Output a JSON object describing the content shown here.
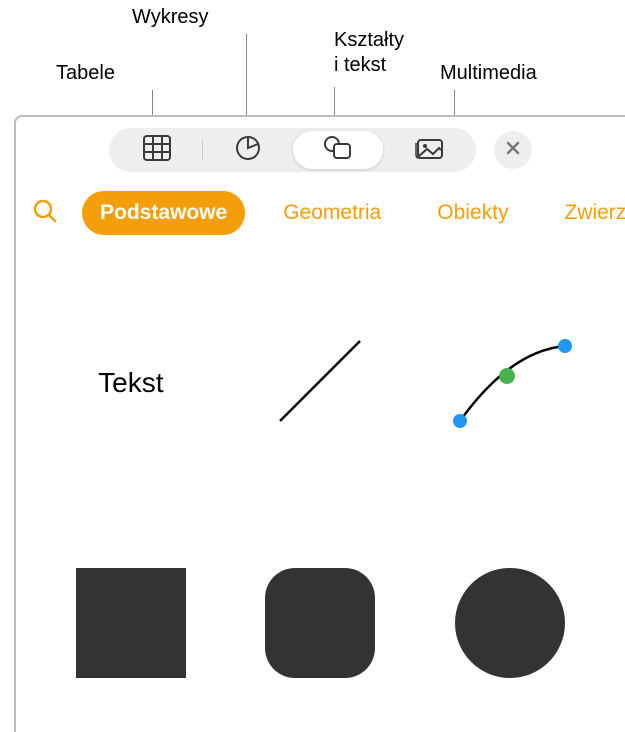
{
  "callouts": {
    "tables": "Tabele",
    "charts": "Wykresy",
    "shapes_text": "Kształty\ni tekst",
    "media": "Multimedia"
  },
  "toolbar": {
    "tables_btn": "Tabele",
    "charts_btn": "Wykresy",
    "shapes_btn": "Kształty i tekst",
    "media_btn": "Multimedia",
    "close_btn": "Zamknij"
  },
  "categories": {
    "search": "Szukaj",
    "items": [
      {
        "label": "Podstawowe",
        "selected": true
      },
      {
        "label": "Geometria",
        "selected": false
      },
      {
        "label": "Obiekty",
        "selected": false
      },
      {
        "label": "Zwierzę",
        "selected": false
      }
    ]
  },
  "shapes": {
    "text_label": "Tekst",
    "line": "Linia",
    "curve": "Krzywa",
    "square": "Kwadrat",
    "rounded": "Zaokrąglony prostokąt",
    "circle": "Koło"
  }
}
